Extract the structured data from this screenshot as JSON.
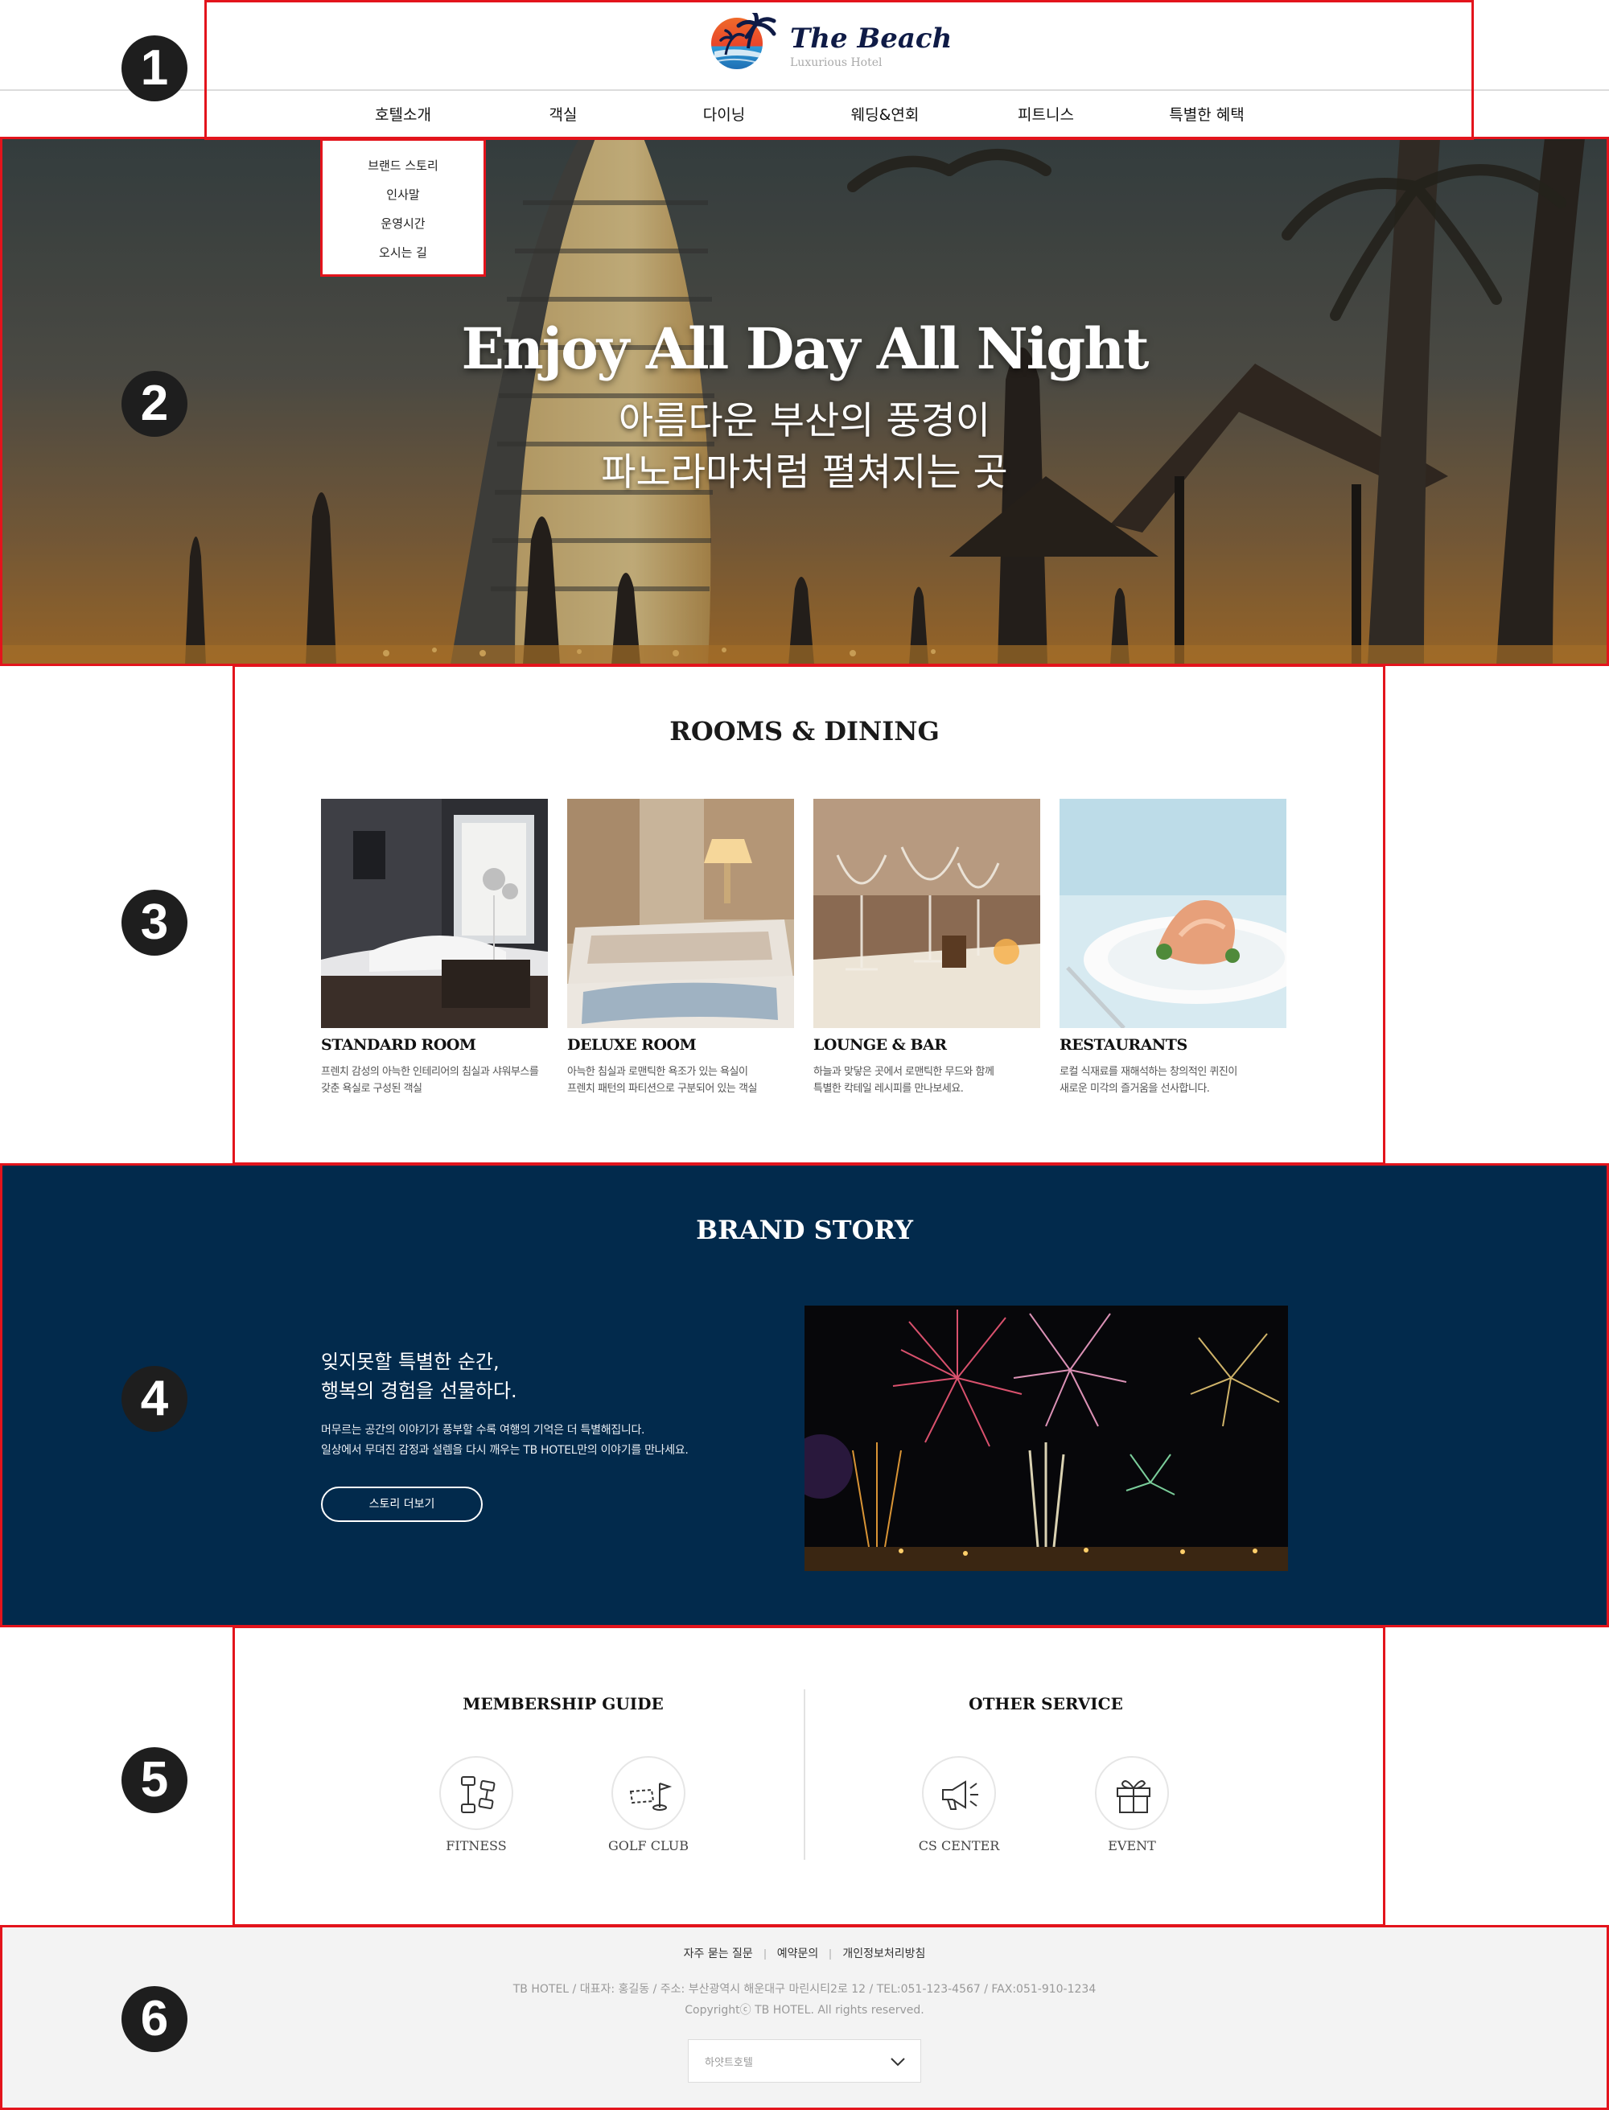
{
  "annotations": {
    "badges": [
      "1",
      "2",
      "3",
      "4",
      "5",
      "6"
    ]
  },
  "header": {
    "logo": {
      "title": "The Beach",
      "subtitle": "Luxurious Hotel"
    },
    "nav": [
      "호텔소개",
      "객실",
      "다이닝",
      "웨딩&연회",
      "피트니스",
      "특별한 혜택"
    ],
    "submenu": [
      "브랜드 스토리",
      "인사말",
      "운영시간",
      "오시는 길"
    ]
  },
  "hero": {
    "title": "Enjoy All Day All Night",
    "subtitle_line1": "아름다운 부산의 풍경이",
    "subtitle_line2": "파노라마처럼 펼쳐지는 곳"
  },
  "rooms": {
    "title": "ROOMS & DINING",
    "cards": [
      {
        "title": "STANDARD ROOM",
        "desc1": "프렌치 감성의 아늑한 인테리어의 침실과 샤워부스를",
        "desc2": "갖춘 욕실로 구성된 객실"
      },
      {
        "title": "DELUXE ROOM",
        "desc1": "아늑한 침실과 로맨틱한 욕조가 있는 욕실이",
        "desc2": "프렌치 패턴의 파티션으로 구분되어 있는 객실"
      },
      {
        "title": "LOUNGE & BAR",
        "desc1": "하늘과 맞닿은 곳에서 로맨틱한 무드와 함께",
        "desc2": "특별한 칵테일 레시피를 만나보세요."
      },
      {
        "title": "RESTAURANTS",
        "desc1": "로컬 식재료를 재해석하는 창의적인 퀴진이",
        "desc2": "새로운 미각의 즐거움을 선사합니다."
      }
    ]
  },
  "brand": {
    "title": "BRAND STORY",
    "heading1": "잊지못할 특별한 순간,",
    "heading2": "행복의 경험을 선물하다.",
    "body1": "머무르는 공간의 이야기가 풍부할 수록 여행의 기억은 더 특별해집니다.",
    "body2": "일상에서 무뎌진 감정과 설렘을 다시 깨우는 TB HOTEL만의 이야기를 만나세요.",
    "button": "스토리 더보기"
  },
  "guide": {
    "membership_title": "MEMBERSHIP GUIDE",
    "other_title": "OTHER SERVICE",
    "items": [
      {
        "label": "FITNESS",
        "icon": "dumbbell-icon"
      },
      {
        "label": "GOLF CLUB",
        "icon": "golf-flag-icon"
      },
      {
        "label": "CS CENTER",
        "icon": "megaphone-icon"
      },
      {
        "label": "EVENT",
        "icon": "gift-icon"
      }
    ]
  },
  "footer": {
    "links": [
      "자주 묻는 질문",
      "예약문의",
      "개인정보처리방침"
    ],
    "info": "TB HOTEL / 대표자: 홍길동 / 주소: 부산광역시 해운대구 마린시티2로 12 / TEL:051-123-4567 / FAX:051-910-1234",
    "copyright": "Copyrightⓒ TB HOTEL. All rights reserved.",
    "select": "하얏트호텔"
  },
  "colors": {
    "annotation_red": "#e3141c",
    "brand_bg": "#022a4c",
    "footer_bg": "#f3f3f3",
    "badge": "#1e1e1e"
  }
}
